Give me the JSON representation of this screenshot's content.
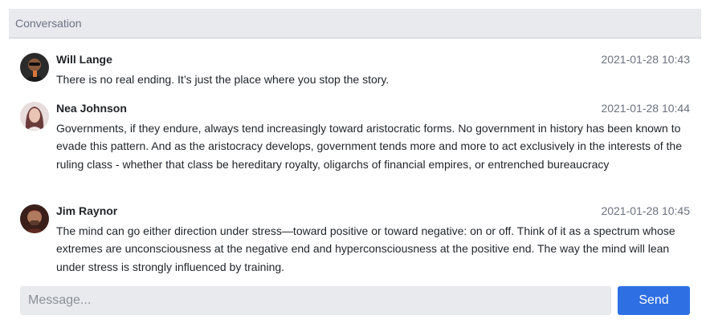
{
  "header": {
    "title": "Conversation"
  },
  "messages": [
    {
      "name": "Will Lange",
      "time": "2021-01-28 10:43",
      "text": "There is no real ending. It’s just the place where you stop the story.",
      "avatar_icon": "user-avatar-icon"
    },
    {
      "name": "Nea Johnson",
      "time": "2021-01-28 10:44",
      "text": "Governments, if they endure, always tend increasingly toward aristocratic forms. No government in history has been known to evade this pattern. And as the aristocracy develops, government tends more and more to act exclusively in the interests of the ruling class - whether that class be hereditary royalty, oligarchs of financial empires, or entrenched bureaucracy",
      "avatar_icon": "user-avatar-icon"
    },
    {
      "name": "Jim Raynor",
      "time": "2021-01-28 10:45",
      "text": "The mind can go either direction under stress—toward positive or toward negative: on or off. Think of it as a spectrum whose extremes are unconsciousness at the negative end and hyperconsciousness at the positive end. The way the mind will lean under stress is strongly influenced by training.",
      "avatar_icon": "user-avatar-icon"
    }
  ],
  "composer": {
    "placeholder": "Message...",
    "value": "",
    "send_label": "Send"
  },
  "colors": {
    "accent": "#2f6fe4",
    "header_bg": "#e9eaee",
    "muted_text": "#6b7280"
  }
}
